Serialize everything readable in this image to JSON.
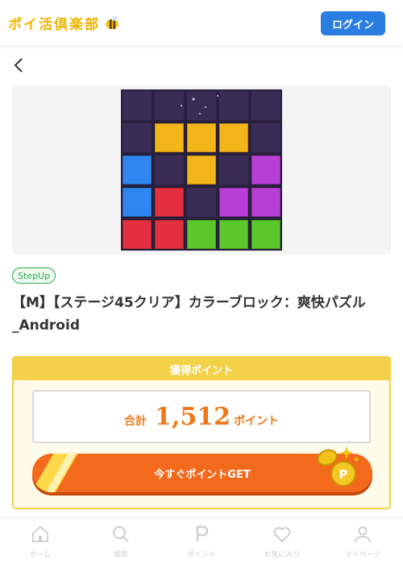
{
  "header": {
    "logo_text": "ポイ活倶楽部",
    "login_label": "ログイン"
  },
  "offer": {
    "badge": "StepUp",
    "title": "【M】【ステージ45クリア】カラーブロック：爽快パズル_Android"
  },
  "points": {
    "heading": "獲得ポイント",
    "total_label": "合計",
    "total_value": "1,512",
    "unit": "ポイント",
    "cta_label": "今すぐポイントGET"
  },
  "tabs": [
    {
      "label": "ホーム",
      "icon": "home-icon"
    },
    {
      "label": "検索",
      "icon": "search-icon"
    },
    {
      "label": "ポイント",
      "icon": "point-icon"
    },
    {
      "label": "お気に入り",
      "icon": "heart-icon"
    },
    {
      "label": "マイページ",
      "icon": "user-icon"
    }
  ],
  "colors": {
    "accent": "#2a7de1",
    "cta": "#f46a1c",
    "gold": "#f3d24a",
    "badge": "#2fa84f"
  }
}
